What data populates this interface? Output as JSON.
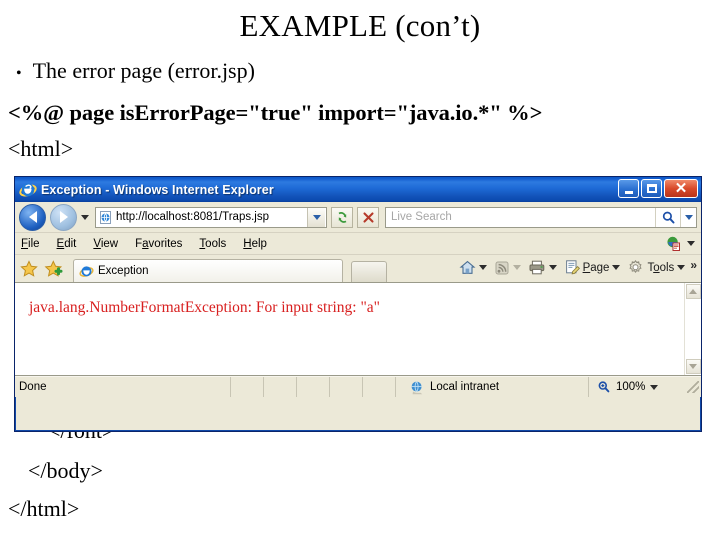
{
  "slide": {
    "title": "EXAMPLE (con’t)",
    "bullet_marker": "•",
    "bullet_text": "The error page (error.jsp)",
    "code_lines": {
      "directive": "<%@ page isErrorPage=\"true\" import=\"java.io.*\" %>",
      "html_open": "<html>",
      "font_close": "</font>",
      "body_close": "</body>",
      "html_close": "</html>"
    }
  },
  "browser": {
    "titlebar": {
      "title": "Exception - Windows Internet Explorer",
      "app_icon": "ie-logo-icon",
      "minimize_label": "Minimize",
      "maximize_label": "Maximize",
      "close_label": "Close"
    },
    "navigation": {
      "back_label": "Back",
      "forward_label": "Forward",
      "recent_pages_label": "Recent Pages",
      "address_icon": "page-icon",
      "address_value": "http://localhost:8081/Traps.jsp",
      "refresh_label": "Refresh",
      "stop_label": "Stop",
      "search_placeholder": "Live Search",
      "search_go_label": "Search",
      "search_options_label": "Search Options"
    },
    "menu": {
      "items": [
        {
          "pre": "",
          "accel": "F",
          "post": "ile"
        },
        {
          "pre": "",
          "accel": "E",
          "post": "dit"
        },
        {
          "pre": "",
          "accel": "V",
          "post": "iew"
        },
        {
          "pre": "F",
          "accel": "a",
          "post": "vorites"
        },
        {
          "pre": "",
          "accel": "T",
          "post": "ools"
        },
        {
          "pre": "",
          "accel": "H",
          "post": "elp"
        }
      ]
    },
    "tabs": {
      "favorites_center_label": "Favorites Center",
      "add_to_favorites_label": "Add to Favorites",
      "active_tab_label": "Exception",
      "active_tab_icon": "ie-page-icon",
      "new_tab_label": "New Tab"
    },
    "commands": {
      "home_label": "Home",
      "feeds_label": "Feeds",
      "print_label": "Print",
      "page": {
        "pre": "",
        "accel": "P",
        "post": "age"
      },
      "tools": {
        "pre": "T",
        "accel": "o",
        "post": "ols"
      },
      "overflow_label": "»"
    },
    "content": {
      "error_text": "java.lang.NumberFormatException: For input string: \"a\"",
      "error_color": "#d81f1f",
      "scroll_up_label": "Scroll up",
      "scroll_down_label": "Scroll down"
    },
    "statusbar": {
      "status_text": "Done",
      "zone_icon": "globe-icon",
      "zone_text": "Local intranet",
      "zoom_icon": "zoom-icon",
      "zoom_level": "100%",
      "zoom_menu_label": "Change Zoom Level"
    }
  }
}
